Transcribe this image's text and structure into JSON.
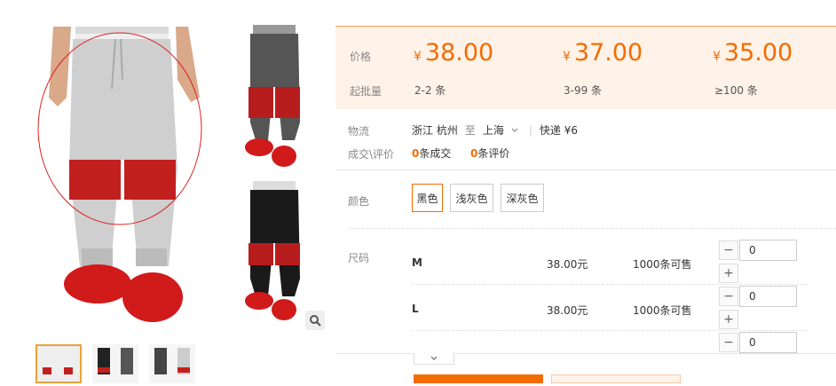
{
  "gallery": {
    "thumbs": [
      "thumb-1",
      "thumb-2",
      "thumb-3",
      "thumb-4"
    ],
    "zoom_icon": "search-icon"
  },
  "price_panel": {
    "price_label": "价格",
    "batch_label": "起批量",
    "tiers": [
      {
        "currency": "¥",
        "price": "38.00",
        "qty": "2-2 条"
      },
      {
        "currency": "¥",
        "price": "37.00",
        "qty": "3-99 条"
      },
      {
        "currency": "¥",
        "price": "35.00",
        "qty": "≥100 条"
      }
    ]
  },
  "logistics": {
    "label": "物流",
    "from": "浙江 杭州",
    "to_word": "至",
    "to": "上海",
    "express": "快递 ¥6"
  },
  "deals": {
    "label": "成交\\评价",
    "deal_count": "0",
    "deal_text": "条成交",
    "review_count": "0",
    "review_text": "条评价"
  },
  "colors": {
    "label": "颜色",
    "options": [
      "黑色",
      "浅灰色",
      "深灰色"
    ],
    "selected": "黑色"
  },
  "sizes": {
    "label": "尺码",
    "rows": [
      {
        "size": "M",
        "price": "38.00元",
        "stock": "1000条可售",
        "qty": "0"
      },
      {
        "size": "L",
        "price": "38.00元",
        "stock": "1000条可售",
        "qty": "0"
      },
      {
        "qty": "0"
      }
    ]
  },
  "accent_color": "#f26c00"
}
